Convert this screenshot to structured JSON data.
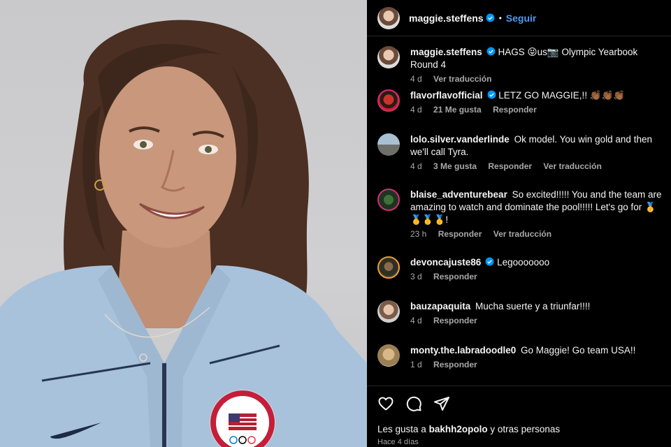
{
  "header": {
    "username": "maggie.steffens",
    "separator": "•",
    "follow_label": "Seguir"
  },
  "caption": {
    "username": "maggie.steffens",
    "text": "HAGS 😝us📷 Olympic Yearbook Round 4",
    "time": "4 d",
    "translate_label": "Ver traducción"
  },
  "comments": [
    {
      "username": "flavorflavofficial",
      "verified": true,
      "text": "LETZ GO MAGGIE,!! 👏🏾👏🏾👏🏾",
      "time": "4 d",
      "likes": "21 Me gusta",
      "reply_label": "Responder",
      "translate_label": ""
    },
    {
      "username": "lolo.silver.vanderlinde",
      "verified": false,
      "text": "Ok model. You win gold and then we'll call Tyra.",
      "time": "4 d",
      "likes": "3 Me gusta",
      "reply_label": "Responder",
      "translate_label": "Ver traducción"
    },
    {
      "username": "blaise_adventurebear",
      "verified": false,
      "text": "So excited!!!!! You and the team are amazing to watch and dominate the pool!!!!! Let's go for 🥇🥇🥇🥇!",
      "time": "23 h",
      "likes": "",
      "reply_label": "Responder",
      "translate_label": "Ver traducción"
    },
    {
      "username": "devoncajuste86",
      "verified": true,
      "text": "Legooooooo",
      "time": "3 d",
      "likes": "",
      "reply_label": "Responder",
      "translate_label": ""
    },
    {
      "username": "bauzapaquita",
      "verified": false,
      "text": "Mucha suerte y a triunfar!!!!",
      "time": "4 d",
      "likes": "",
      "reply_label": "Responder",
      "translate_label": ""
    },
    {
      "username": "monty.the.labradoodle0",
      "verified": false,
      "text": "Go Maggie! Go team USA!!",
      "time": "1 d",
      "likes": "",
      "reply_label": "Responder",
      "translate_label": ""
    }
  ],
  "footer": {
    "likes_prefix": "Les gusta a",
    "likes_user": "bakhh2opolo",
    "likes_suffix": "y otras personas",
    "time_ago": "Hace 4 días"
  },
  "photo": {
    "badge_text": "UNITED STATES"
  },
  "colors": {
    "accent_blue": "#4a9bf5",
    "verified_blue": "#0095f6",
    "muted": "#a8a8a8"
  }
}
